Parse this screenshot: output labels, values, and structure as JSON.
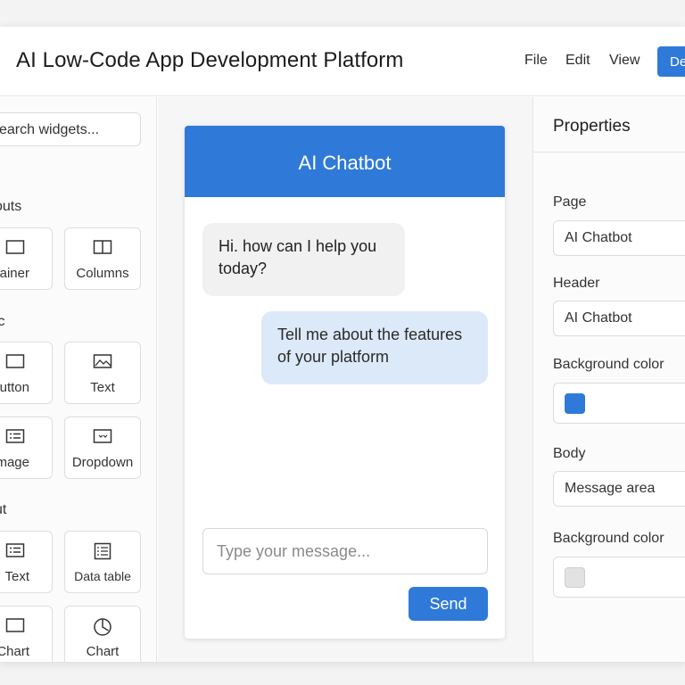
{
  "app": {
    "title": "AI Low-Code App Development Platform",
    "menu": [
      "File",
      "Edit",
      "View"
    ],
    "deploy_label": "De"
  },
  "sidebar": {
    "search_placeholder": "earch widgets...",
    "sections": [
      "outs",
      "ic",
      "ut"
    ],
    "widgets": [
      {
        "label": "ntainer",
        "icon": "container-icon"
      },
      {
        "label": "Columns",
        "icon": "columns-icon"
      },
      {
        "label": "utton",
        "icon": "button-icon"
      },
      {
        "label": "Text",
        "icon": "image-icon"
      },
      {
        "label": "mage",
        "icon": "list-icon"
      },
      {
        "label": "Dropdown",
        "icon": "dropdown-icon"
      },
      {
        "label": "Text",
        "icon": "text-list-icon"
      },
      {
        "label": "Data table",
        "icon": "data-table-icon"
      },
      {
        "label": "Chart",
        "icon": "chart-box-icon"
      },
      {
        "label": "Chart",
        "icon": "pie-chart-icon"
      }
    ]
  },
  "chat": {
    "header": "AI Chatbot",
    "bot_message": "Hi. how can I help you today?",
    "user_message": "Tell me about the features of your platform",
    "input_placeholder": "Type your message...",
    "send_label": "Send"
  },
  "properties": {
    "title": "Properties",
    "page_label": "Page",
    "page_value": "AI Chatbot",
    "header_label": "Header",
    "header_value": "AI Chatbot",
    "bg_label": "Background color",
    "body_label": "Body",
    "body_value": "Message area",
    "bg2_label": "Background color",
    "colors": {
      "header_bg": "#2f7ad9",
      "body_bg": "#e2e2e2"
    }
  }
}
